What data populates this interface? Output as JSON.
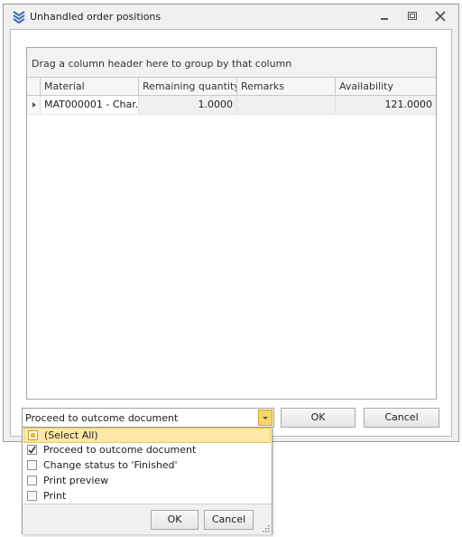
{
  "window": {
    "title": "Unhandled order positions",
    "icon": "chevrons-down-icon",
    "controls": [
      "minimize-icon",
      "restore-icon",
      "close-icon"
    ]
  },
  "grid": {
    "group_panel_text": "Drag a column header here to group by that column",
    "columns": [
      "Material",
      "Remaining quantity",
      "Remarks",
      "Availability"
    ],
    "rows": [
      {
        "material": "MAT000001 - Char...",
        "remaining_quantity": "1.0000",
        "remarks": "",
        "availability": "121.0000"
      }
    ]
  },
  "action": {
    "selected": "Proceed to outcome document",
    "ok_label": "OK",
    "cancel_label": "Cancel"
  },
  "dropdown": {
    "options": [
      {
        "label": "(Select All)",
        "state": "partial",
        "highlighted": true
      },
      {
        "label": "Proceed to outcome document",
        "state": "checked",
        "highlighted": false
      },
      {
        "label": "Change status to 'Finished'",
        "state": "unchecked",
        "highlighted": false
      },
      {
        "label": "Print preview",
        "state": "unchecked",
        "highlighted": false
      },
      {
        "label": "Print",
        "state": "unchecked",
        "highlighted": false
      }
    ],
    "ok_label": "OK",
    "cancel_label": "Cancel"
  },
  "colors": {
    "accent": "#3b6fb6",
    "highlight": "#fde8a8",
    "dropdown_button": "#f5d76b"
  }
}
